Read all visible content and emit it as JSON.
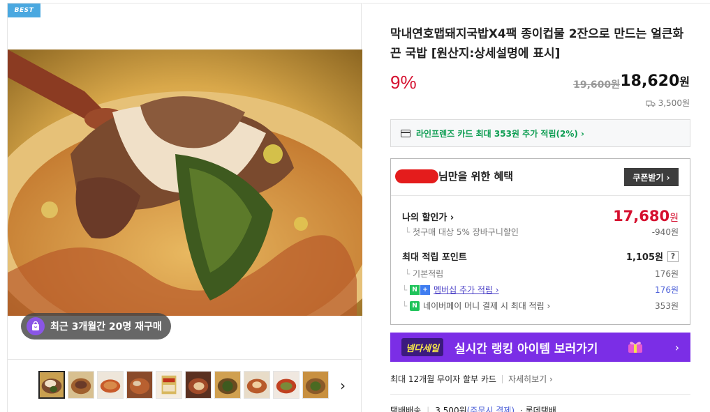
{
  "gallery": {
    "badge": "BEST",
    "repurchase": "최근 3개월간 20명 재구매",
    "thumbnail_count": 10,
    "next_arrow": "›"
  },
  "product": {
    "title": "막내연호맵돼지국밥X4팩 종이컵물 2잔으로 만드는 얼큰화끈 국밥 [원산지:상세설명에 표시]",
    "discount": "9%",
    "original_price": "19,600원",
    "sale_price": "18,620",
    "sale_unit": "원",
    "delivery_fee": "3,500원"
  },
  "card_banner": {
    "text": "라인프렌즈 카드 최대 353원 추가 적립(2%) ›"
  },
  "benefits": {
    "title_suffix": "님만을 위한 혜택",
    "coupon_button": "쿠폰받기 ›",
    "my_price_label": "나의 할인가 ›",
    "my_price_value": "17,680",
    "my_price_unit": "원",
    "first_purchase_label": "첫구매 대상 5% 장바구니할인",
    "first_purchase_value": "-940원",
    "max_point_label": "최대 적립 포인트",
    "max_point_value": "1,105원",
    "help": "?",
    "basic_label": "기본적립",
    "basic_value": "176원",
    "membership_badge_n": "N",
    "membership_badge_plus": "+",
    "membership_label": "멤버십 추가 적립 ›",
    "membership_value": "176원",
    "naverpay_badge": "N",
    "naverpay_label": "네이버페이 머니 결제 시 최대 적립 ›",
    "naverpay_value": "353원"
  },
  "ranking_banner": {
    "logo": "넴다세일",
    "text": "실시간 랭킹 아이템 보러가기",
    "arrow": "›"
  },
  "installment": {
    "text": "최대 12개월 무이자 할부 카드",
    "more": "자세히보기 ›"
  },
  "shipping": {
    "method": "택배배송",
    "fee": "3,500원",
    "fee_note": "(주문시 결제)",
    "carrier": "· 롯데택배"
  },
  "colors": {
    "discount_red": "#d5102f",
    "card_green": "#0d9d52",
    "ranking_purple": "#7b2ee6",
    "badge_blue": "#4aa8e0"
  }
}
